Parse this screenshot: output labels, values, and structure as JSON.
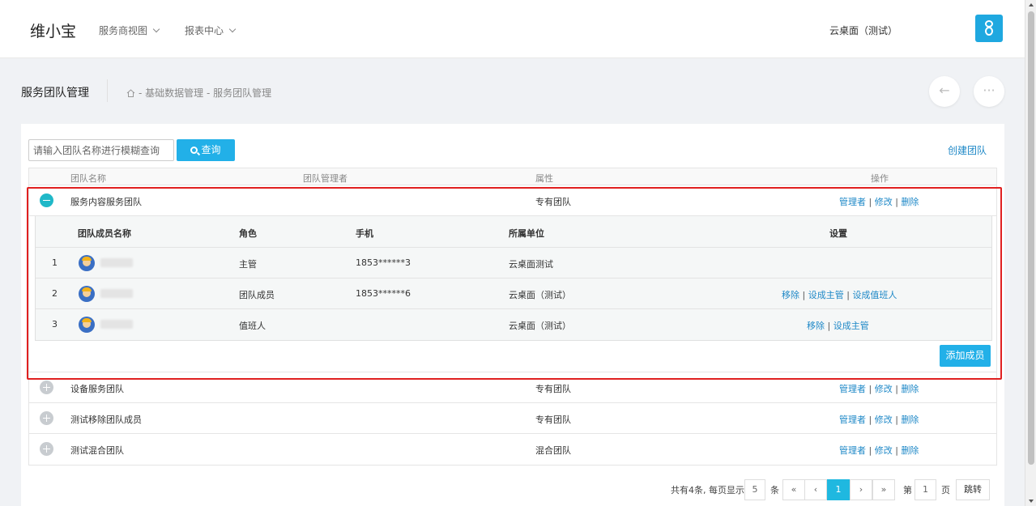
{
  "topbar": {
    "logo": "维小宝",
    "nav": [
      {
        "label": "服务商视图"
      },
      {
        "label": "报表中心"
      }
    ],
    "tenant": "云桌面（测试）",
    "user_icon": "user-icon"
  },
  "page": {
    "title": "服务团队管理",
    "breadcrumb": "- 基础数据管理 - 服务团队管理",
    "back_icon": "←",
    "more_icon": "···"
  },
  "search": {
    "placeholder": "请输入团队名称进行模糊查询",
    "button": "查询",
    "create_link": "创建团队"
  },
  "table": {
    "headers": {
      "name": "团队名称",
      "manager": "团队管理者",
      "attr": "属性",
      "ops": "操作"
    },
    "op_labels": {
      "manager": "管理者",
      "edit": "修改",
      "delete": "删除",
      "sep": "|"
    },
    "rows": [
      {
        "name": "服务内容服务团队",
        "manager": "",
        "attr": "专有团队",
        "expanded": true
      },
      {
        "name": "设备服务团队",
        "manager": "",
        "attr": "专有团队",
        "expanded": false
      },
      {
        "name": "测试移除团队成员",
        "manager": "",
        "attr": "专有团队",
        "expanded": false
      },
      {
        "name": "测试混合团队",
        "manager": "",
        "attr": "混合团队",
        "expanded": false
      }
    ]
  },
  "members": {
    "headers": {
      "name": "团队成员名称",
      "role": "角色",
      "phone": "手机",
      "unit": "所属单位",
      "settings": "设置"
    },
    "rows": [
      {
        "index": "1",
        "role": "主管",
        "phone": "1853******3",
        "unit": "云桌面测试",
        "actions": []
      },
      {
        "index": "2",
        "role": "团队成员",
        "phone": "1853******6",
        "unit": "云桌面（测试）",
        "actions": [
          "移除",
          "设成主管",
          "设成值班人"
        ]
      },
      {
        "index": "3",
        "role": "值班人",
        "phone": "",
        "unit": "云桌面（测试）",
        "actions": [
          "移除",
          "设成主管"
        ]
      }
    ],
    "add_button": "添加成员"
  },
  "pagination": {
    "summary": "共有4条, 每页显示",
    "page_size": "5",
    "unit": "条",
    "first": "«",
    "prev": "‹",
    "current": "1",
    "next": "›",
    "last": "»",
    "goto_prefix": "第",
    "goto_value": "1",
    "goto_suffix": "页",
    "jump": "跳转"
  }
}
